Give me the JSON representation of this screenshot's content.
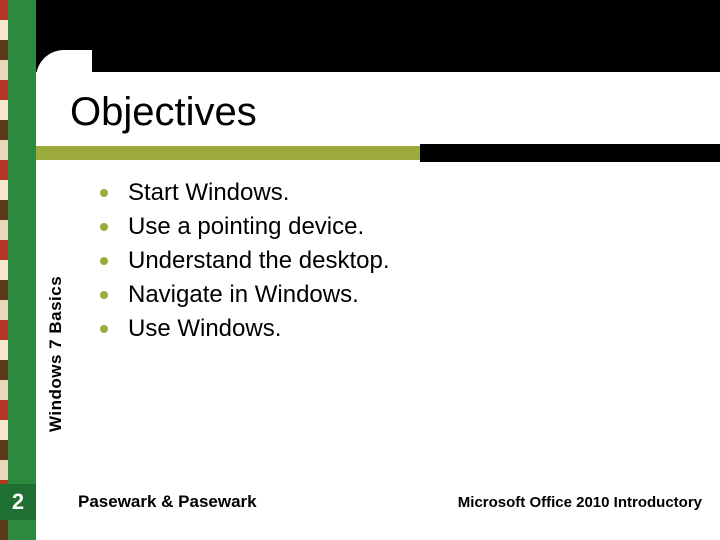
{
  "title": "Objectives",
  "sidebar_label": "Windows 7 Basics",
  "page_number": "2",
  "footer_left": "Pasewark & Pasewark",
  "footer_right": "Microsoft Office 2010 Introductory",
  "bullets": [
    "Start Windows.",
    "Use a pointing device.",
    "Understand the desktop.",
    "Navigate in Windows.",
    "Use Windows."
  ]
}
